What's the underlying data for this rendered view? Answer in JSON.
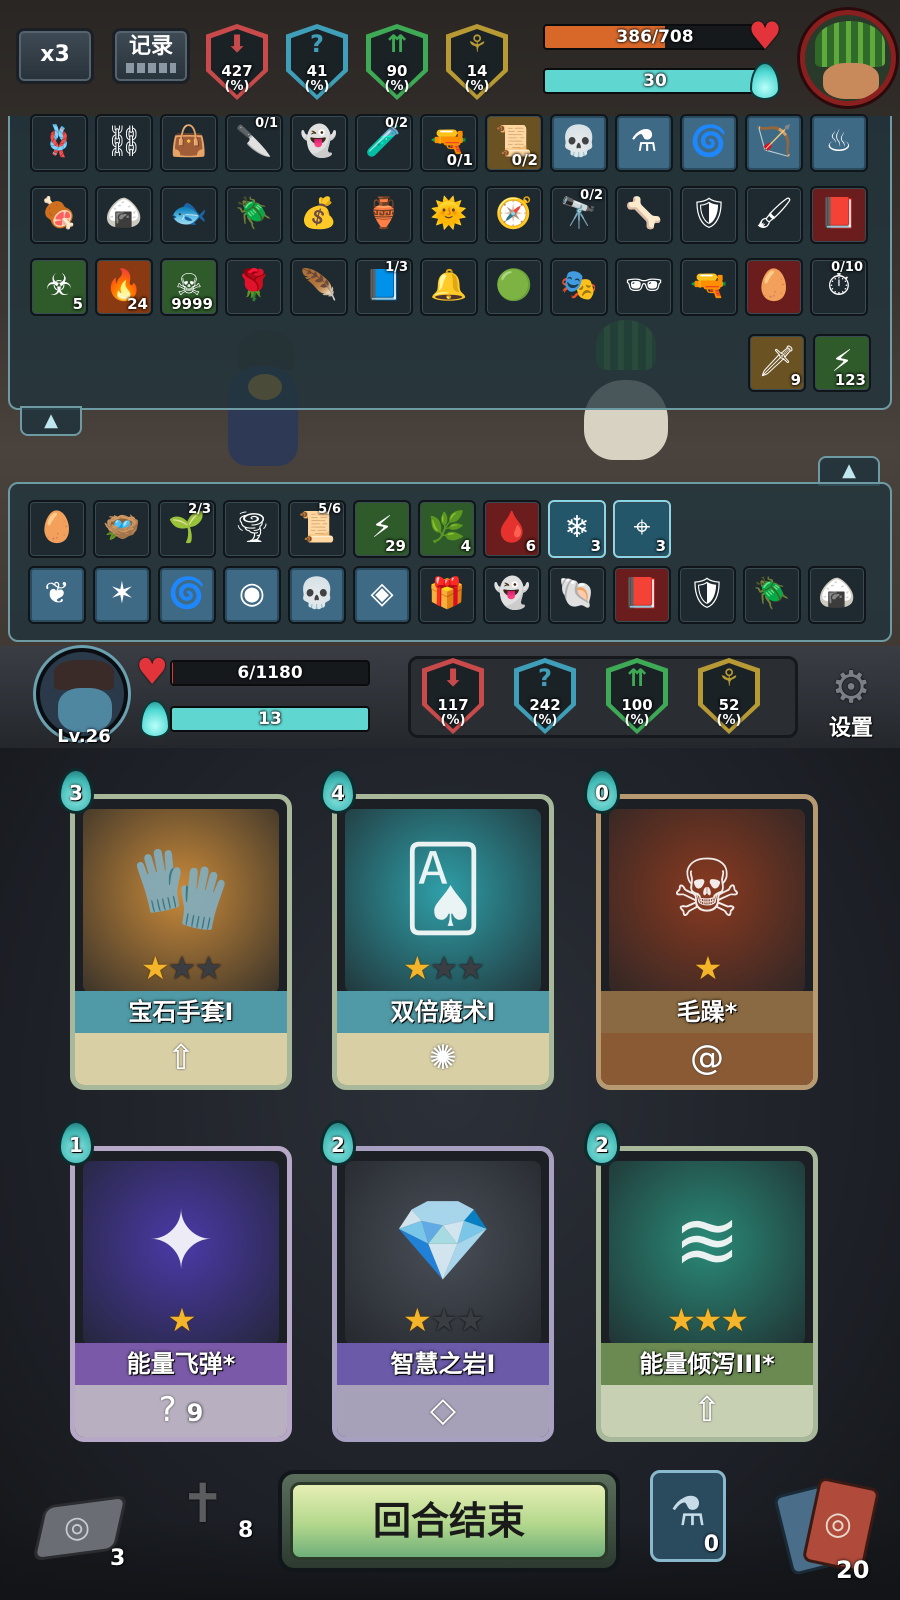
{
  "top_bar": {
    "speed_label": "x3",
    "log_label": "记录",
    "enemy_stats": [
      {
        "value": "427",
        "unit": "(%)",
        "color": "#c94a4a",
        "symbol": "⬇",
        "icon": "attack-down-icon"
      },
      {
        "value": "41",
        "unit": "(%)",
        "color": "#3f9fb8",
        "symbol": "?",
        "icon": "mystery-icon"
      },
      {
        "value": "90",
        "unit": "(%)",
        "color": "#3faa55",
        "symbol": "⇈",
        "icon": "growth-icon"
      },
      {
        "value": "14",
        "unit": "(%)",
        "color": "#b89a35",
        "symbol": "⚘",
        "icon": "luck-icon"
      }
    ],
    "enemy_hp": {
      "text": "386/708",
      "current": 386,
      "max": 708,
      "color": "#d8682a"
    },
    "enemy_mana": {
      "text": "30",
      "fraction": 1.0,
      "color": "#5fd6d0"
    }
  },
  "enemy_items": {
    "rows": [
      [
        {
          "icon": "rope-icon",
          "glyph": "🪢",
          "style": "dark"
        },
        {
          "icon": "trap-icon",
          "glyph": "⛓",
          "style": "dark"
        },
        {
          "icon": "bag-icon",
          "glyph": "👜",
          "style": "dark"
        },
        {
          "icon": "knife-icon",
          "glyph": "🔪",
          "style": "dark",
          "count_top": "0/1"
        },
        {
          "icon": "ghost-doll-icon",
          "glyph": "👻",
          "style": "dark"
        },
        {
          "icon": "potion-icon",
          "glyph": "🧪",
          "style": "dark",
          "count_top": "0/2"
        },
        {
          "icon": "bullet-icon",
          "glyph": "🔫",
          "style": "dark",
          "count": "0/1"
        },
        {
          "icon": "scroll-icon",
          "glyph": "📜",
          "style": "gold",
          "count": "0/2"
        },
        {
          "icon": "skull-rune-icon",
          "glyph": "💀",
          "style": "blue"
        },
        {
          "icon": "flask-rune-icon",
          "glyph": "⚗",
          "style": "blue"
        },
        {
          "icon": "swirl-rune-icon",
          "glyph": "🌀",
          "style": "blue"
        },
        {
          "icon": "bow-rune-icon",
          "glyph": "🏹",
          "style": "blue"
        },
        {
          "icon": "water-rune-icon",
          "glyph": "♨",
          "style": "blue"
        }
      ],
      [
        {
          "icon": "bone-icon",
          "glyph": "🍖",
          "style": "dark"
        },
        {
          "icon": "rice-ball-icon",
          "glyph": "🍙",
          "style": "dark"
        },
        {
          "icon": "fish-icon",
          "glyph": "🐟",
          "style": "dark"
        },
        {
          "icon": "beetle-icon",
          "glyph": "🪲",
          "style": "dark"
        },
        {
          "icon": "pouch-icon",
          "glyph": "💰",
          "style": "dark"
        },
        {
          "icon": "jar-icon",
          "glyph": "🏺",
          "style": "dark"
        },
        {
          "icon": "sun-orb-icon",
          "glyph": "🌞",
          "style": "dark"
        },
        {
          "icon": "compass-icon",
          "glyph": "🧭",
          "style": "dark"
        },
        {
          "icon": "binoculars-icon",
          "glyph": "🔭",
          "style": "dark",
          "count_top": "0/2"
        },
        {
          "icon": "claw-icon",
          "glyph": "🦴",
          "style": "dark"
        },
        {
          "icon": "shield-icon",
          "glyph": "🛡",
          "style": "dark"
        },
        {
          "icon": "brush-icon",
          "glyph": "🖌",
          "style": "dark"
        },
        {
          "icon": "spellbook-icon",
          "glyph": "📕",
          "style": "red"
        }
      ],
      [
        {
          "icon": "poison-icon",
          "glyph": "☣",
          "style": "green",
          "count": "5"
        },
        {
          "icon": "burn-icon",
          "glyph": "🔥",
          "style": "orange",
          "count": "24"
        },
        {
          "icon": "skull-mark-icon",
          "glyph": "☠",
          "style": "green",
          "count": "9999"
        },
        {
          "icon": "rose-icon",
          "glyph": "🌹",
          "style": "dark"
        },
        {
          "icon": "red-feather-icon",
          "glyph": "🪶",
          "style": "dark"
        },
        {
          "icon": "tome-icon",
          "glyph": "📘",
          "style": "dark",
          "count_top": "1/3"
        },
        {
          "icon": "bells-icon",
          "glyph": "🔔",
          "style": "dark"
        },
        {
          "icon": "slime-icon",
          "glyph": "🟢",
          "style": "dark"
        },
        {
          "icon": "mask-icon",
          "glyph": "🎭",
          "style": "dark"
        },
        {
          "icon": "eyepatch-icon",
          "glyph": "🕶",
          "style": "dark"
        },
        {
          "icon": "pistol-icon",
          "glyph": "🔫",
          "style": "dark"
        },
        {
          "icon": "dragon-egg-icon",
          "glyph": "🥚",
          "style": "red"
        },
        {
          "icon": "pocket-watch-icon",
          "glyph": "⏱",
          "style": "dark",
          "count_top": "0/10"
        }
      ]
    ],
    "extra": [
      {
        "icon": "sword-buff-icon",
        "glyph": "🗡",
        "style": "gold",
        "count": "9"
      },
      {
        "icon": "green-slash-icon",
        "glyph": "⚡",
        "style": "green",
        "count": "123"
      }
    ]
  },
  "player_items": {
    "rows": [
      [
        {
          "icon": "egg-icon",
          "glyph": "🥚",
          "style": "dark"
        },
        {
          "icon": "nest-icon",
          "glyph": "🪺",
          "style": "dark"
        },
        {
          "icon": "plant-icon",
          "glyph": "🌱",
          "style": "dark",
          "count_top": "2/3"
        },
        {
          "icon": "tornado-icon",
          "glyph": "🌪",
          "style": "dark"
        },
        {
          "icon": "scroll-icon",
          "glyph": "📜",
          "style": "dark",
          "count_top": "5/6"
        },
        {
          "icon": "green-slash-icon",
          "glyph": "⚡",
          "style": "green",
          "count": "29"
        },
        {
          "icon": "sprout-icon",
          "glyph": "🌿",
          "style": "green",
          "count": "4"
        },
        {
          "icon": "red-claw-icon",
          "glyph": "🩸",
          "style": "red",
          "count": "6"
        },
        {
          "icon": "snowflake-icon",
          "glyph": "❄",
          "style": "cyan",
          "count": "3"
        },
        {
          "icon": "target-icon",
          "glyph": "⌖",
          "style": "cyan",
          "count": "3"
        }
      ],
      [
        {
          "icon": "branch-rune-icon",
          "glyph": "❦",
          "style": "blue"
        },
        {
          "icon": "crack-rune-icon",
          "glyph": "✶",
          "style": "blue"
        },
        {
          "icon": "swirl-rune-icon",
          "glyph": "🌀",
          "style": "blue"
        },
        {
          "icon": "mouth-rune-icon",
          "glyph": "◉",
          "style": "blue"
        },
        {
          "icon": "skull-rune-icon",
          "glyph": "💀",
          "style": "blue"
        },
        {
          "icon": "shatter-rune-icon",
          "glyph": "◈",
          "style": "blue"
        },
        {
          "icon": "gift-pile-icon",
          "glyph": "🎁",
          "style": "dark"
        },
        {
          "icon": "ghost-doll-icon",
          "glyph": "👻",
          "style": "dark"
        },
        {
          "icon": "spiral-egg-icon",
          "glyph": "🐚",
          "style": "dark"
        },
        {
          "icon": "spellbook-icon",
          "glyph": "📕",
          "style": "red"
        },
        {
          "icon": "shield-icon",
          "glyph": "🛡",
          "style": "dark"
        },
        {
          "icon": "beetle-icon",
          "glyph": "🪲",
          "style": "dark"
        },
        {
          "icon": "rice-ball-icon",
          "glyph": "🍙",
          "style": "dark"
        }
      ]
    ]
  },
  "player_status": {
    "level": "Lv.26",
    "hp": {
      "text": "6/1180",
      "current": 6,
      "max": 1180,
      "color": "#d83a3a"
    },
    "mana": {
      "text": "13",
      "fraction": 1.0,
      "color": "#5fd6d0"
    },
    "stats": [
      {
        "value": "117",
        "unit": "(%)",
        "color": "#c94a4a",
        "symbol": "⬇",
        "icon": "attack-down-icon"
      },
      {
        "value": "242",
        "unit": "(%)",
        "color": "#3f9fb8",
        "symbol": "?",
        "icon": "mystery-icon"
      },
      {
        "value": "100",
        "unit": "(%)",
        "color": "#3faa55",
        "symbol": "⇈",
        "icon": "growth-icon"
      },
      {
        "value": "52",
        "unit": "(%)",
        "color": "#b89a35",
        "symbol": "⚘",
        "icon": "luck-icon"
      }
    ],
    "settings_label": "设置"
  },
  "hand": [
    {
      "name": "宝石手套I",
      "cost": "3",
      "stars": 1,
      "max_stars": 3,
      "art_color": "#c98a3a",
      "art_glyph": "🧤",
      "frame": "#a8b89a",
      "bar_color": "#4f9aa6",
      "bottom_color": "#d8cfa4",
      "bottom_glyph": "⇧",
      "bottom_count": "",
      "icon": "gem-gauntlet-icon",
      "bottom_icon": "upgrade-arrow-icon"
    },
    {
      "name": "双倍魔术I",
      "cost": "4",
      "stars": 1,
      "max_stars": 3,
      "art_color": "#2f9fa8",
      "art_glyph": "🂡",
      "frame": "#a8b89a",
      "bar_color": "#4f9aa6",
      "bottom_color": "#d8cfa4",
      "bottom_glyph": "✺",
      "bottom_count": "",
      "icon": "double-magic-icon",
      "bottom_icon": "whistle-icon"
    },
    {
      "name": "毛躁*",
      "cost": "0",
      "stars": 1,
      "max_stars": 1,
      "art_color": "#8a3a20",
      "art_glyph": "☠",
      "frame": "#b89a72",
      "bar_color": "#8a6a42",
      "bottom_color": "#8a5a34",
      "bottom_glyph": "@",
      "bottom_count": "",
      "icon": "irritable-icon",
      "bottom_icon": "spiral-icon"
    },
    {
      "name": "能量飞弹*",
      "cost": "1",
      "stars": 1,
      "max_stars": 1,
      "art_color": "#4a3aa8",
      "art_glyph": "✦",
      "frame": "#b8a8c8",
      "bar_color": "#7a5aa8",
      "bottom_color": "#b8b0c0",
      "bottom_glyph": "?",
      "bottom_count": "9",
      "icon": "energy-missile-icon",
      "bottom_icon": "hook-icon"
    },
    {
      "name": "智慧之岩I",
      "cost": "2",
      "stars": 1,
      "max_stars": 3,
      "art_color": "#4a4f58",
      "art_glyph": "💎",
      "frame": "#a8a0c0",
      "bar_color": "#6a5aa8",
      "bottom_color": "#a6a0b8",
      "bottom_glyph": "◇",
      "bottom_count": "",
      "icon": "wisdom-rock-icon",
      "bottom_icon": "diamond-icon"
    },
    {
      "name": "能量倾泻III*",
      "cost": "2",
      "stars": 3,
      "max_stars": 3,
      "art_color": "#2a8a78",
      "art_glyph": "≋",
      "frame": "#a8b89a",
      "bar_color": "#6a8a52",
      "bottom_color": "#c8d0b4",
      "bottom_glyph": "⇧",
      "bottom_count": "",
      "icon": "energy-torrent-icon",
      "bottom_icon": "upgrade-arrow-icon"
    }
  ],
  "bottom_bar": {
    "discard_count": "3",
    "grave_count": "8",
    "end_turn_label": "回合结束",
    "potion_count": "0",
    "deck_count": "20"
  }
}
